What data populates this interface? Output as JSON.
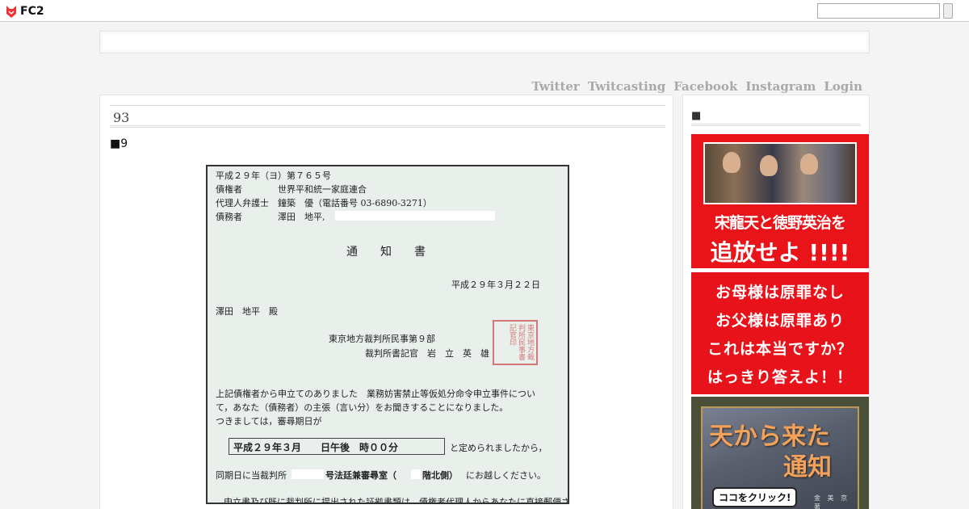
{
  "fc2": {
    "logo_text": "FC2",
    "search_value": ""
  },
  "nav": {
    "links": [
      "Twitter",
      "Twitcasting",
      "Facebook",
      "Instagram",
      "Login"
    ]
  },
  "post": {
    "title": "93",
    "number_label": "■9",
    "document": {
      "lines": [
        "平成２９年（ヨ）第７６５号",
        "債権者　　　　世界平和統一家庭連合",
        "代理人弁護士　鐘築　優（電話番号 03-6890-3271）",
        "債務者　　　　澤田　地平,",
        "通　　知　　書",
        "平成２９年３月２２日",
        "澤田　地平　殿",
        "東京地方裁判所民事第９部",
        "裁判所書記官　岩　立　英　雄",
        "上記債権者から申立てのありました　業務妨害禁止等仮処分命令申立事件につい",
        "て，あなた（債務者）の主張（言い分）をお聞きすることになりました。",
        "つきましては，審尋期日が",
        "と定められましたから，",
        "同期日に当裁判所",
        "号法廷兼審尋室（",
        "階北側）",
        "にお越しください。",
        "申立書及び既に裁判所に提出された証拠書類は，債権者代理人からあなたに直接郵便されま"
      ],
      "date_box": "平成２９年３月　　日午後　時００分",
      "seal_text": "東京地方裁判所民事書記官印"
    }
  },
  "sidebar": {
    "title": "■",
    "banner1": {
      "line1": "宋龍天と徳野英治を",
      "line2": "追放せよ !!!!"
    },
    "banner2": {
      "lines": [
        "お母様は原罪なし",
        "お父様は原罪あり",
        "これは本当ですか？",
        "はっきり答えよ！！"
      ]
    },
    "banner3": {
      "title1": "天から来た",
      "title2": "通知",
      "click_label": "ココをクリック!",
      "author": "金 美 京 著"
    }
  }
}
